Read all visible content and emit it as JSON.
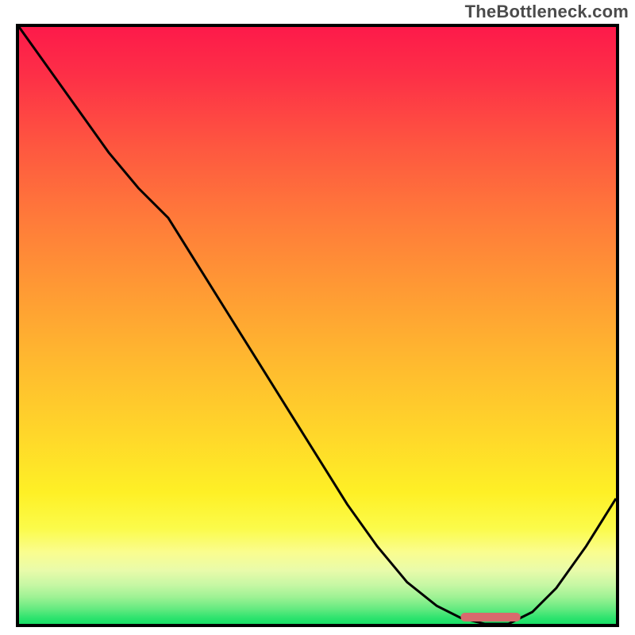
{
  "watermark": "TheBottleneck.com",
  "chart_data": {
    "type": "line",
    "title": "",
    "xlabel": "",
    "ylabel": "",
    "xlim": [
      0,
      100
    ],
    "ylim": [
      0,
      100
    ],
    "grid": false,
    "legend": false,
    "series": [
      {
        "name": "bottleneck-curve",
        "x": [
          0,
          5,
          10,
          15,
          20,
          25,
          30,
          35,
          40,
          45,
          50,
          55,
          60,
          65,
          70,
          74,
          78,
          82,
          86,
          90,
          95,
          100
        ],
        "y": [
          100,
          93,
          86,
          79,
          73,
          68,
          60,
          52,
          44,
          36,
          28,
          20,
          13,
          7,
          3,
          1,
          0,
          0,
          2,
          6,
          13,
          21
        ]
      }
    ],
    "marker": {
      "name": "optimal-range",
      "x_start": 74,
      "x_end": 84,
      "y": 0.8,
      "color": "#d86a6d"
    },
    "background": {
      "type": "vertical-gradient",
      "stops": [
        {
          "pos": 0.0,
          "color": "#fd1a4a"
        },
        {
          "pos": 0.5,
          "color": "#ffb92f"
        },
        {
          "pos": 0.8,
          "color": "#fef026"
        },
        {
          "pos": 0.92,
          "color": "#c6f7a4"
        },
        {
          "pos": 1.0,
          "color": "#18df65"
        }
      ]
    }
  }
}
